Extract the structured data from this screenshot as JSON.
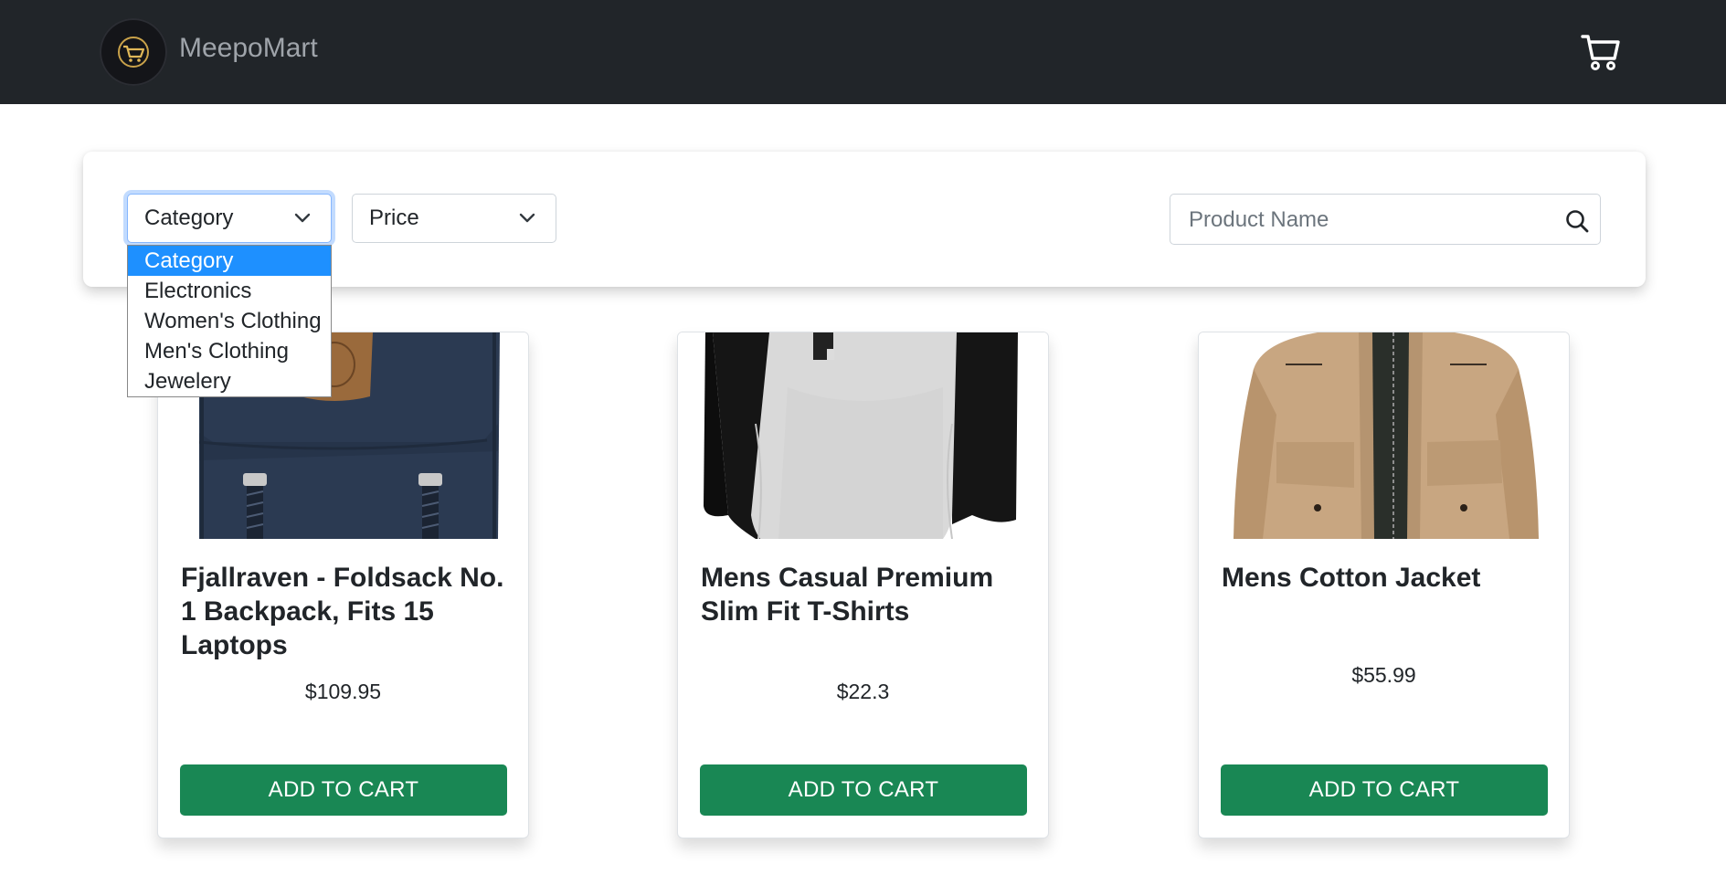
{
  "navbar": {
    "brand_name": "MeepoMart",
    "logo_icon": "shopping-cart-logo-icon",
    "cart_icon": "cart-icon",
    "background": "#212529"
  },
  "filters": {
    "category": {
      "selected": "Category",
      "options": [
        "Category",
        "Electronics",
        "Women's Clothing",
        "Men's Clothing",
        "Jewelery"
      ]
    },
    "price": {
      "selected": "Price"
    },
    "search": {
      "placeholder": "Product Name",
      "value": ""
    }
  },
  "products": [
    {
      "title": "Fjallraven - Foldsack No. 1 Backpack, Fits 15 Laptops",
      "price": "$109.95",
      "button": "ADD TO CART",
      "image": "backpack"
    },
    {
      "title": "Mens Casual Premium Slim Fit T-Shirts",
      "price": "$22.3",
      "button": "ADD TO CART",
      "image": "t-shirt"
    },
    {
      "title": "Mens Cotton Jacket",
      "price": "$55.99",
      "button": "ADD TO CART",
      "image": "jacket"
    }
  ],
  "colors": {
    "accent": "#198754",
    "highlight": "#1e90ff"
  }
}
